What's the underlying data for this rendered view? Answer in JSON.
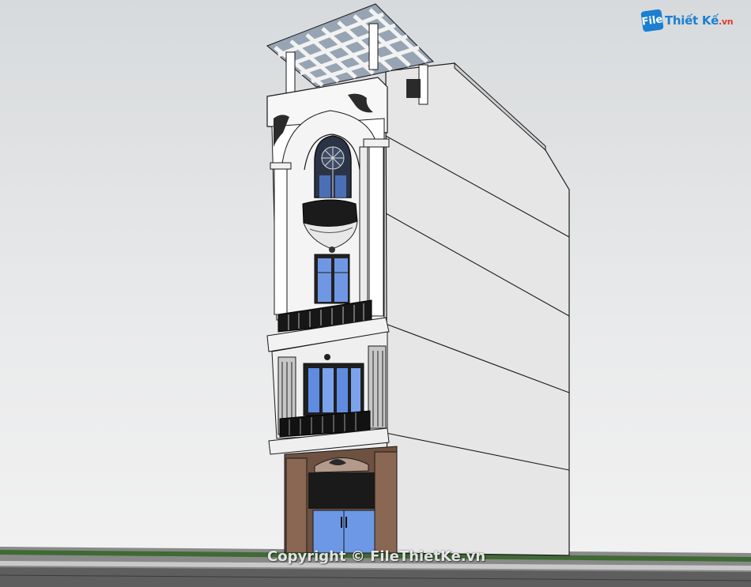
{
  "watermark": {
    "text": "Copyright © FileThietKe.vn"
  },
  "logo": {
    "mark": "File",
    "name": "Thiết Kế",
    "suffix": ".vn"
  },
  "colors": {
    "sky": "#d7dadc",
    "wall_white": "#ffffff",
    "side_wall": "#e4e4e4",
    "glass": "#7fa6ea",
    "railing": "#151515",
    "wood": "#7b5a45",
    "ground": "#3f6a33",
    "road": "#5e5e5e"
  }
}
